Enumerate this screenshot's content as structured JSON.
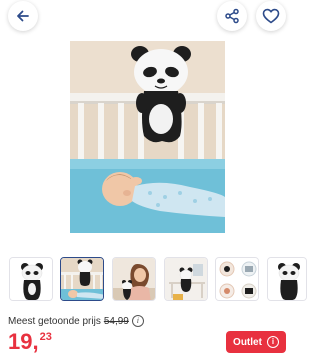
{
  "header": {
    "back_icon": "arrow-left-icon",
    "share_icon": "share-icon",
    "favorite_icon": "heart-icon",
    "accent_color": "#2d4b8a"
  },
  "gallery": {
    "main_image": "panda-crib-baby-photo",
    "thumbnails": [
      {
        "image": "panda-plush"
      },
      {
        "image": "panda-crib-baby",
        "active": true
      },
      {
        "image": "girl-with-panda"
      },
      {
        "image": "panda-in-room"
      },
      {
        "image": "product-detail-collage"
      },
      {
        "image": "panda-plush-partial"
      }
    ]
  },
  "pricing": {
    "lowest_label": "Meest getoonde prijs",
    "lowest_price": "54,99",
    "price_int": "19,",
    "price_dec": "23",
    "price_color": "#e8313f",
    "outlet_label": "Outlet",
    "outlet_info": "i",
    "info_icon": "i"
  }
}
